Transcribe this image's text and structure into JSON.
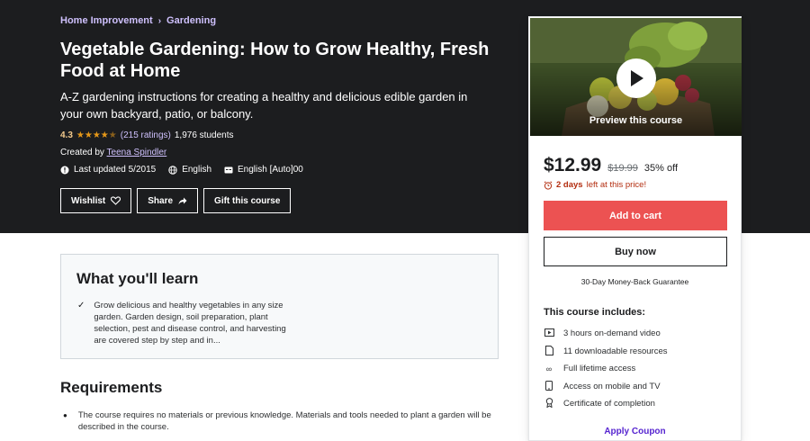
{
  "breadcrumb": {
    "items": [
      "Home Improvement",
      "Gardening"
    ]
  },
  "course": {
    "title": "Vegetable Gardening: How to Grow Healthy, Fresh Food at Home",
    "subtitle": "A-Z gardening instructions for creating a healthy and delicious edible garden in your own backyard, patio, or balcony.",
    "rating": "4.3",
    "stars_value": 4.3,
    "ratings_count": "(215 ratings)",
    "students": "1,976 students",
    "created_by_label": "Created by",
    "instructor": "Teena Spindler",
    "last_updated": "Last updated 5/2015",
    "language": "English",
    "captions": "English [Auto]00"
  },
  "actions": {
    "wishlist": "Wishlist",
    "share": "Share",
    "gift": "Gift this course"
  },
  "learn": {
    "title": "What you'll learn",
    "items": [
      "Grow delicious and healthy vegetables in any size garden. Garden design, soil preparation, plant selection, pest and disease control, and harvesting are covered step by step and in..."
    ]
  },
  "requirements": {
    "title": "Requirements",
    "items": [
      "The course requires no materials or previous knowledge. Materials and tools needed to plant a garden will be described in the course."
    ]
  },
  "sidebar": {
    "preview_label": "Preview this course",
    "price": "$12.99",
    "original_price": "$19.99",
    "discount": "35% off",
    "countdown_bold": "2 days",
    "countdown_rest": "left at this price!",
    "add_to_cart": "Add to cart",
    "buy_now": "Buy now",
    "guarantee": "30-Day Money-Back Guarantee",
    "includes_title": "This course includes:",
    "includes": [
      {
        "icon": "video-icon",
        "text": "3 hours on-demand video"
      },
      {
        "icon": "file-icon",
        "text": "11 downloadable resources"
      },
      {
        "icon": "infinity-icon",
        "text": "Full lifetime access"
      },
      {
        "icon": "mobile-icon",
        "text": "Access on mobile and TV"
      },
      {
        "icon": "trophy-icon",
        "text": "Certificate of completion"
      }
    ],
    "apply_coupon": "Apply Coupon"
  },
  "colors": {
    "hero_bg": "#1c1d1f",
    "accent_link": "#cec0fc",
    "star": "#e59819",
    "cart_button": "#ec5252",
    "countdown": "#b32d0f",
    "coupon_link": "#5624d0"
  }
}
